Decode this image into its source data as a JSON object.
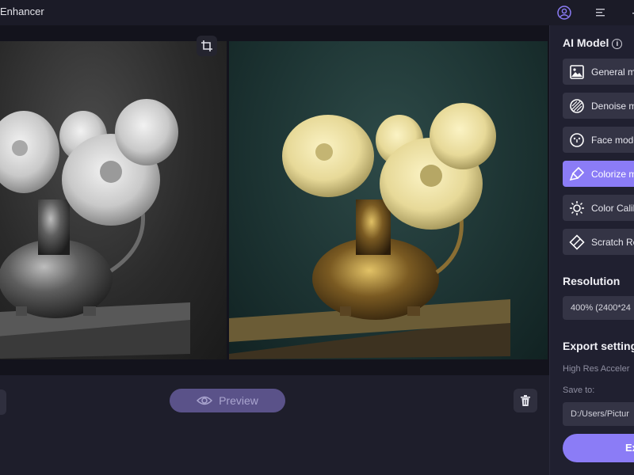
{
  "app": {
    "title": "Enhancer"
  },
  "titlebar": {
    "icons": [
      "account-icon",
      "menu-icon",
      "minimize-icon"
    ]
  },
  "canvas": {
    "crop_icon": "crop-icon"
  },
  "toolbar": {
    "preview_label": "Preview",
    "delete_icon": "trash-icon"
  },
  "panel": {
    "ai_model_title": "AI Model",
    "ai_model_info": "i",
    "models": [
      {
        "label": "General m",
        "icon": "image-icon",
        "active": false
      },
      {
        "label": "Denoise m",
        "icon": "denoise-icon",
        "active": false
      },
      {
        "label": "Face mode",
        "icon": "face-icon",
        "active": false
      },
      {
        "label": "Colorize m",
        "icon": "brush-icon",
        "active": true
      },
      {
        "label": "Color Calil",
        "icon": "sun-icon",
        "active": false
      },
      {
        "label": "Scratch Re",
        "icon": "scratch-icon",
        "active": false
      }
    ],
    "resolution_title": "Resolution",
    "resolution_value": "400% (2400*24",
    "export_settings_title": "Export setting",
    "high_res_label": "High Res Acceler",
    "save_to_label": "Save to:",
    "save_path": "D:/Users/Pictur",
    "export_label": "Ex"
  },
  "colors": {
    "accent": "#8b7cf6",
    "panel_bg": "#202030",
    "app_bg": "#1b1b27"
  }
}
